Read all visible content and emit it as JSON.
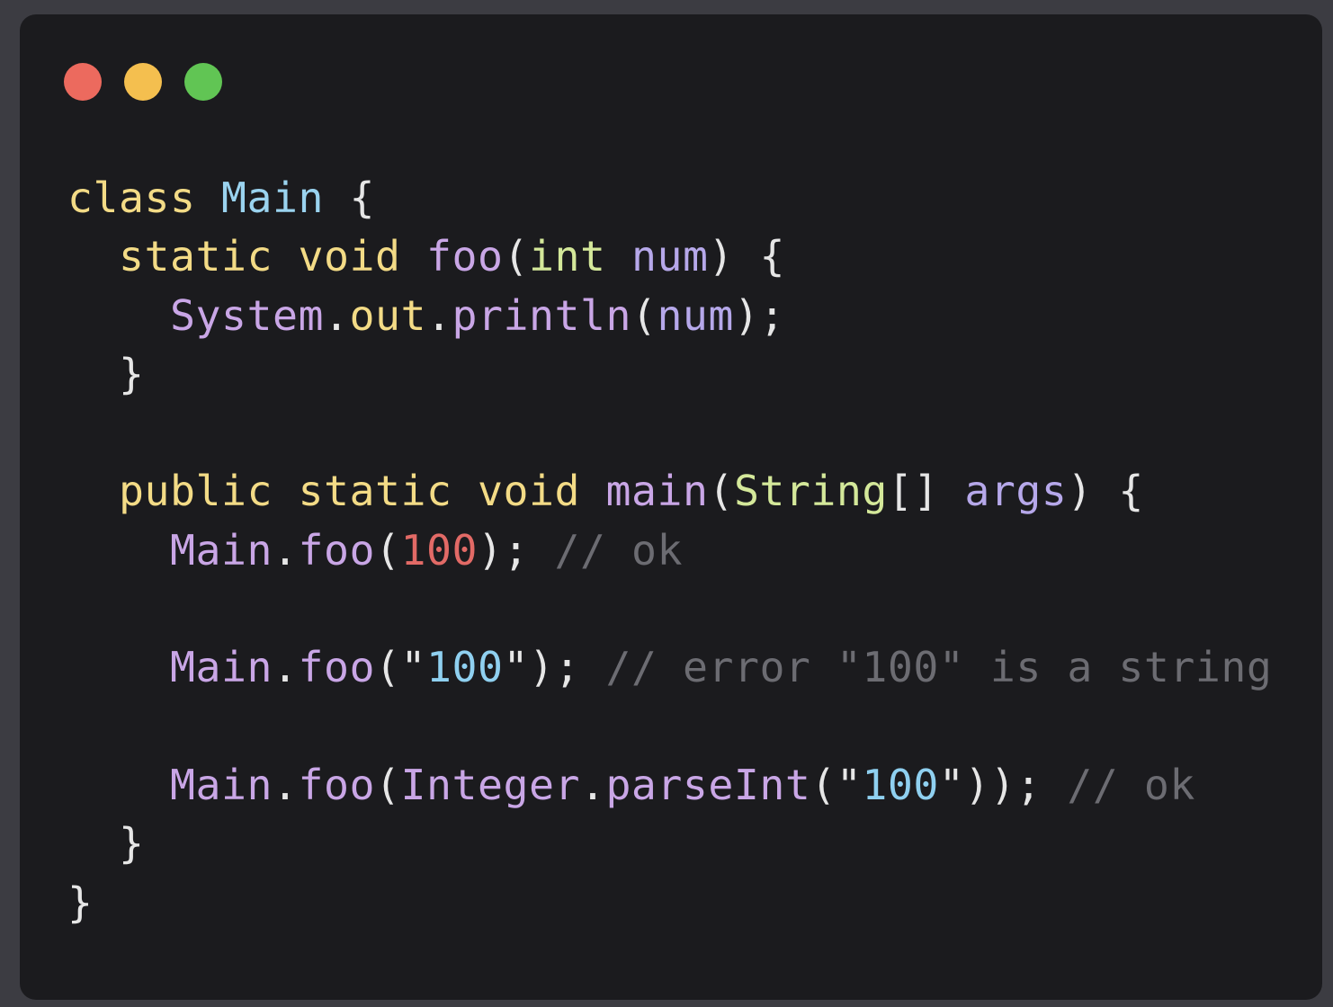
{
  "window": {
    "controls": [
      {
        "name": "close",
        "color": "#ec6a5e"
      },
      {
        "name": "minimize",
        "color": "#f4bf4f"
      },
      {
        "name": "zoom",
        "color": "#61c554"
      }
    ]
  },
  "code": {
    "lines": [
      [
        {
          "text": "class",
          "kind": "keyword"
        },
        {
          "text": " ",
          "kind": "punct"
        },
        {
          "text": "Main",
          "kind": "type"
        },
        {
          "text": " {",
          "kind": "punct"
        }
      ],
      [
        {
          "text": "  ",
          "kind": "punct"
        },
        {
          "text": "static",
          "kind": "keyword"
        },
        {
          "text": " ",
          "kind": "punct"
        },
        {
          "text": "void",
          "kind": "keyword"
        },
        {
          "text": " ",
          "kind": "punct"
        },
        {
          "text": "foo",
          "kind": "method"
        },
        {
          "text": "(",
          "kind": "punct"
        },
        {
          "text": "int",
          "kind": "builtin"
        },
        {
          "text": " ",
          "kind": "punct"
        },
        {
          "text": "num",
          "kind": "param"
        },
        {
          "text": ") {",
          "kind": "punct"
        }
      ],
      [
        {
          "text": "    ",
          "kind": "punct"
        },
        {
          "text": "System",
          "kind": "method"
        },
        {
          "text": ".",
          "kind": "punct"
        },
        {
          "text": "out",
          "kind": "field"
        },
        {
          "text": ".",
          "kind": "punct"
        },
        {
          "text": "println",
          "kind": "method"
        },
        {
          "text": "(",
          "kind": "punct"
        },
        {
          "text": "num",
          "kind": "param"
        },
        {
          "text": ");",
          "kind": "punct"
        }
      ],
      [
        {
          "text": "  }",
          "kind": "punct"
        }
      ],
      [],
      [
        {
          "text": "  ",
          "kind": "punct"
        },
        {
          "text": "public",
          "kind": "keyword"
        },
        {
          "text": " ",
          "kind": "punct"
        },
        {
          "text": "static",
          "kind": "keyword"
        },
        {
          "text": " ",
          "kind": "punct"
        },
        {
          "text": "void",
          "kind": "keyword"
        },
        {
          "text": " ",
          "kind": "punct"
        },
        {
          "text": "main",
          "kind": "method"
        },
        {
          "text": "(",
          "kind": "punct"
        },
        {
          "text": "String",
          "kind": "builtin"
        },
        {
          "text": "[] ",
          "kind": "punct"
        },
        {
          "text": "args",
          "kind": "param"
        },
        {
          "text": ") {",
          "kind": "punct"
        }
      ],
      [
        {
          "text": "    ",
          "kind": "punct"
        },
        {
          "text": "Main",
          "kind": "method"
        },
        {
          "text": ".",
          "kind": "punct"
        },
        {
          "text": "foo",
          "kind": "method"
        },
        {
          "text": "(",
          "kind": "punct"
        },
        {
          "text": "100",
          "kind": "number"
        },
        {
          "text": "); ",
          "kind": "punct"
        },
        {
          "text": "// ok",
          "kind": "comment"
        }
      ],
      [],
      [
        {
          "text": "    ",
          "kind": "punct"
        },
        {
          "text": "Main",
          "kind": "method"
        },
        {
          "text": ".",
          "kind": "punct"
        },
        {
          "text": "foo",
          "kind": "method"
        },
        {
          "text": "(",
          "kind": "punct"
        },
        {
          "text": "\"",
          "kind": "quote"
        },
        {
          "text": "100",
          "kind": "string"
        },
        {
          "text": "\"",
          "kind": "quote"
        },
        {
          "text": "); ",
          "kind": "punct"
        },
        {
          "text": "// error \"100\" is a string",
          "kind": "comment"
        }
      ],
      [],
      [
        {
          "text": "    ",
          "kind": "punct"
        },
        {
          "text": "Main",
          "kind": "method"
        },
        {
          "text": ".",
          "kind": "punct"
        },
        {
          "text": "foo",
          "kind": "method"
        },
        {
          "text": "(",
          "kind": "punct"
        },
        {
          "text": "Integer",
          "kind": "method"
        },
        {
          "text": ".",
          "kind": "punct"
        },
        {
          "text": "parseInt",
          "kind": "method"
        },
        {
          "text": "(",
          "kind": "punct"
        },
        {
          "text": "\"",
          "kind": "quote"
        },
        {
          "text": "100",
          "kind": "string"
        },
        {
          "text": "\"",
          "kind": "quote"
        },
        {
          "text": ")); ",
          "kind": "punct"
        },
        {
          "text": "// ok",
          "kind": "comment"
        }
      ],
      [
        {
          "text": "  }",
          "kind": "punct"
        }
      ],
      [
        {
          "text": "}",
          "kind": "punct"
        }
      ]
    ]
  }
}
